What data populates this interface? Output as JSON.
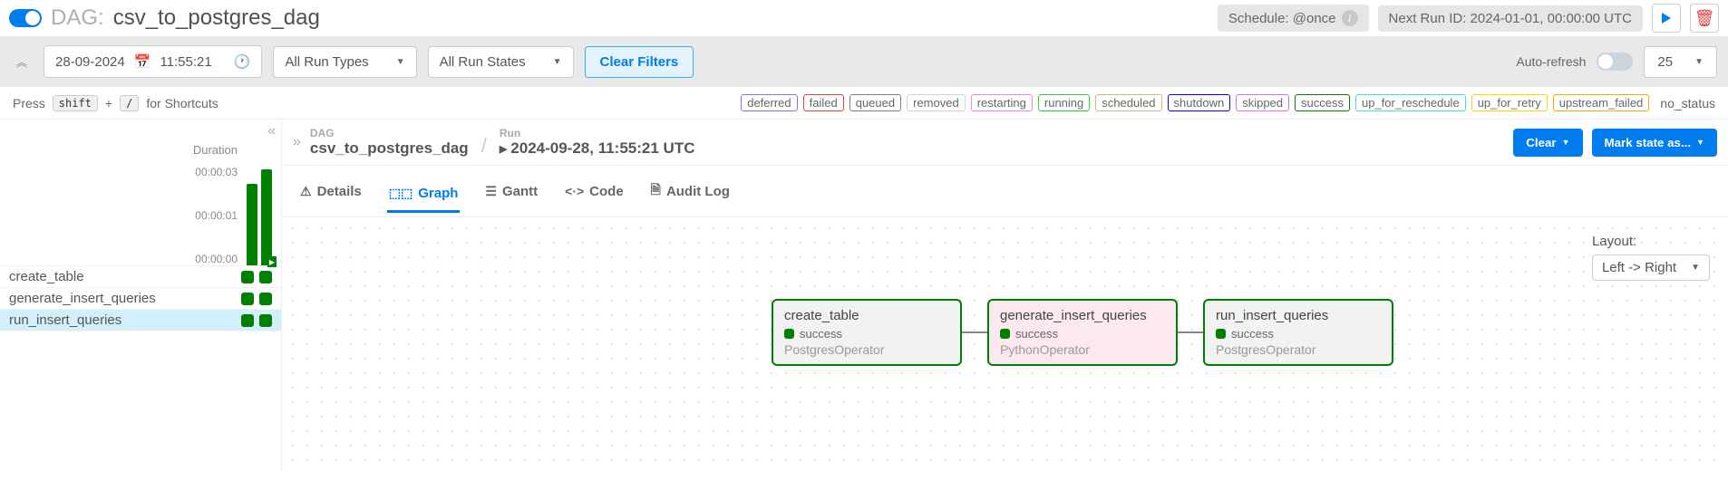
{
  "header": {
    "dag_label": "DAG:",
    "dag_name": "csv_to_postgres_dag",
    "schedule_label": "Schedule: @once",
    "next_run_label": "Next Run ID: 2024-01-01, 00:00:00 UTC"
  },
  "filters": {
    "date": "28-09-2024",
    "time": "11:55:21",
    "run_types": "All Run Types",
    "run_states": "All Run States",
    "clear": "Clear Filters",
    "auto_refresh": "Auto-refresh",
    "page_size": "25"
  },
  "shortcuts": {
    "prefix": "Press",
    "k1": "shift",
    "plus": "+",
    "k2": "/",
    "suffix": "for Shortcuts"
  },
  "statuses": [
    {
      "label": "deferred",
      "color": "#9370db"
    },
    {
      "label": "failed",
      "color": "#e53e3e"
    },
    {
      "label": "queued",
      "color": "#808080"
    },
    {
      "label": "removed",
      "color": "#d3d3d3"
    },
    {
      "label": "restarting",
      "color": "#ee82ee"
    },
    {
      "label": "running",
      "color": "#32cd32"
    },
    {
      "label": "scheduled",
      "color": "#d2b48c"
    },
    {
      "label": "shutdown",
      "color": "#0000ff"
    },
    {
      "label": "skipped",
      "color": "#da70d6"
    },
    {
      "label": "success",
      "color": "#008000"
    },
    {
      "label": "up_for_reschedule",
      "color": "#40e0d0"
    },
    {
      "label": "up_for_retry",
      "color": "#ffd700"
    },
    {
      "label": "upstream_failed",
      "color": "#ffa500"
    }
  ],
  "no_status": "no_status",
  "sidebar": {
    "duration_label": "Duration",
    "ticks": [
      "00:00:03",
      "00:00:01",
      "00:00:00"
    ],
    "tasks": [
      {
        "name": "create_table"
      },
      {
        "name": "generate_insert_queries"
      },
      {
        "name": "run_insert_queries"
      }
    ]
  },
  "breadcrumb": {
    "dag_label": "DAG",
    "dag_value": "csv_to_postgres_dag",
    "run_label": "Run",
    "run_value": "2024-09-28, 11:55:21 UTC",
    "clear_btn": "Clear",
    "mark_btn": "Mark state as..."
  },
  "tabs": {
    "details": "Details",
    "graph": "Graph",
    "gantt": "Gantt",
    "code": "Code",
    "audit": "Audit Log"
  },
  "layout": {
    "label": "Layout:",
    "value": "Left -> Right"
  },
  "nodes": [
    {
      "title": "create_table",
      "status": "success",
      "operator": "PostgresOperator",
      "bg": "gray"
    },
    {
      "title": "generate_insert_queries",
      "status": "success",
      "operator": "PythonOperator",
      "bg": "pink"
    },
    {
      "title": "run_insert_queries",
      "status": "success",
      "operator": "PostgresOperator",
      "bg": "gray"
    }
  ]
}
